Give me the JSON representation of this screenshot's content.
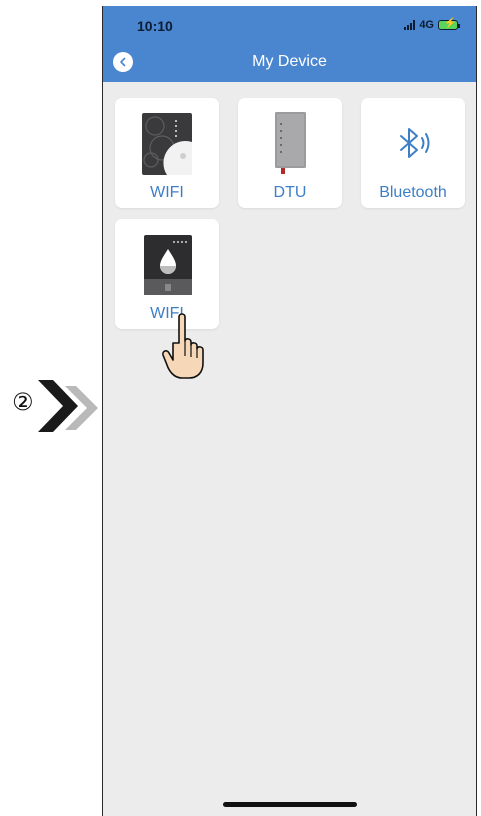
{
  "step": {
    "number": "②"
  },
  "status_bar": {
    "time": "10:10",
    "network": "4G"
  },
  "header": {
    "title": "My Device"
  },
  "devices": [
    {
      "label": "WIFI"
    },
    {
      "label": "DTU"
    },
    {
      "label": "Bluetooth"
    },
    {
      "label": "WIFI"
    }
  ],
  "colors": {
    "accent": "#4a86cf",
    "label": "#3d7fc7",
    "background": "#ececec",
    "battery": "#5bd45a"
  },
  "icons": [
    "chevron-left-icon",
    "signal-icon",
    "battery-charging-icon",
    "bluetooth-icon",
    "pointing-hand-icon",
    "double-chevron-right-icon"
  ]
}
